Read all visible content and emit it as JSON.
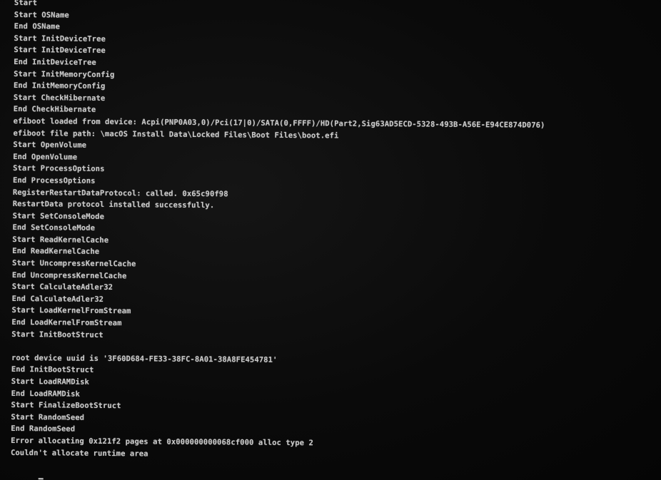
{
  "console": {
    "lines": [
      "Start",
      "Start OSName",
      "End OSName",
      "Start InitDeviceTree",
      "Start InitDeviceTree",
      "End InitDeviceTree",
      "Start InitMemoryConfig",
      "End InitMemoryConfig",
      "Start CheckHibernate",
      "End CheckHibernate",
      "efiboot loaded from device: Acpi(PNP0A03,0)/Pci(17|0)/SATA(0,FFFF)/HD(Part2,Sig63AD5ECD-5328-493B-A56E-E94CE874D076)",
      "efiboot file path: \\macOS Install Data\\Locked Files\\Boot Files\\boot.efi",
      "Start OpenVolume",
      "End OpenVolume",
      "Start ProcessOptions",
      "End ProcessOptions",
      "RegisterRestartDataProtocol: called. 0x65c90f98",
      "RestartData protocol installed successfully.",
      "Start SetConsoleMode",
      "End SetConsoleMode",
      "Start ReadKernelCache",
      "End ReadKernelCache",
      "Start UncompressKernelCache",
      "End UncompressKernelCache",
      "Start CalculateAdler32",
      "End CalculateAdler32",
      "Start LoadKernelFromStream",
      "End LoadKernelFromStream",
      "Start InitBootStruct",
      "",
      "root device uuid is '3F60D684-FE33-38FC-8A01-38A8FE454781'",
      "End InitBootStruct",
      "Start LoadRAMDisk",
      "End LoadRAMDisk",
      "Start FinalizeBootStruct",
      "Start RandomSeed",
      "End RandomSeed",
      "Error allocating 0x121f2 pages at 0x000000000068cf000 alloc type 2",
      "Couldn't allocate runtime area"
    ]
  }
}
